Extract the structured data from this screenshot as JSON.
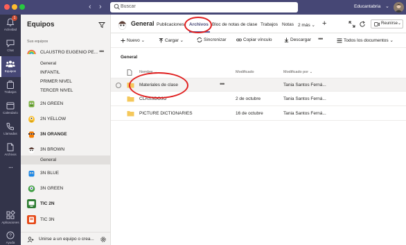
{
  "topbar": {
    "search_placeholder": "Buscar",
    "org_name": "Educantabria",
    "colors": {
      "bar": "#464775",
      "close": "#fe5f57",
      "minimize": "#febc2e",
      "maximize": "#28c840"
    }
  },
  "rail": {
    "items": [
      {
        "label": "Actividad",
        "icon": "bell-icon",
        "badge": "1"
      },
      {
        "label": "Chat",
        "icon": "chat-icon"
      },
      {
        "label": "Equipos",
        "icon": "teams-icon",
        "active": true
      },
      {
        "label": "Trabajos",
        "icon": "assignments-icon"
      },
      {
        "label": "Calendario",
        "icon": "calendar-icon"
      },
      {
        "label": "Llamadas",
        "icon": "phone-icon"
      },
      {
        "label": "Archivos",
        "icon": "files-icon"
      },
      {
        "label": "...",
        "icon": "more-icon"
      }
    ],
    "bottom": [
      {
        "label": "Aplicaciones",
        "icon": "apps-icon"
      },
      {
        "label": "Ayuda",
        "icon": "help-icon"
      }
    ]
  },
  "sidebar": {
    "title": "Equipos",
    "section_label": "Sus equipos",
    "teams": [
      {
        "name": "CLAUSTRO EUGENIO PE...",
        "channels": [
          "General",
          "INFANTIL",
          "PRIMER NIVEL",
          "TERCER NIVEL"
        ]
      },
      {
        "name": "2N GREEN"
      },
      {
        "name": "2N YELLOW"
      },
      {
        "name": "3N ORANGE",
        "bold": true
      },
      {
        "name": "3N BROWN",
        "channels": [
          "General"
        ],
        "active_channel": "General"
      },
      {
        "name": "3N BLUE"
      },
      {
        "name": "3N GREEN"
      },
      {
        "name": "TIC 2N"
      },
      {
        "name": "TIC 3N"
      }
    ],
    "join_label": "Unirse a un equipo o crea..."
  },
  "header": {
    "channel_title": "General",
    "tabs": [
      "Publicaciones",
      "Archivos",
      "Bloc de notas de clase",
      "Trabajos",
      "Notas",
      "2 más"
    ],
    "active_tab": "Archivos",
    "meet_label": "Reunirse",
    "accent": "#6264a7"
  },
  "toolbar": {
    "new": "Nuevo",
    "upload": "Cargar",
    "sync": "Sincronizar",
    "copy_link": "Copiar vínculo",
    "download": "Descargar",
    "view": "Todos los documentos"
  },
  "files": {
    "breadcrumb": "General",
    "columns": {
      "name": "Nombre",
      "modified": "Modificado",
      "modified_by": "Modificado por"
    },
    "rows": [
      {
        "name": "Materiales de clase",
        "modified": "",
        "modified_by": "Tania Santos Ferná..."
      },
      {
        "name": "CLASSDOJO",
        "modified": "2 de octubre",
        "modified_by": "Tania Santos Ferná..."
      },
      {
        "name": "PICTURE DICTIONARIES",
        "modified": "16 de octubre",
        "modified_by": "Tania Santos Ferná..."
      }
    ]
  }
}
